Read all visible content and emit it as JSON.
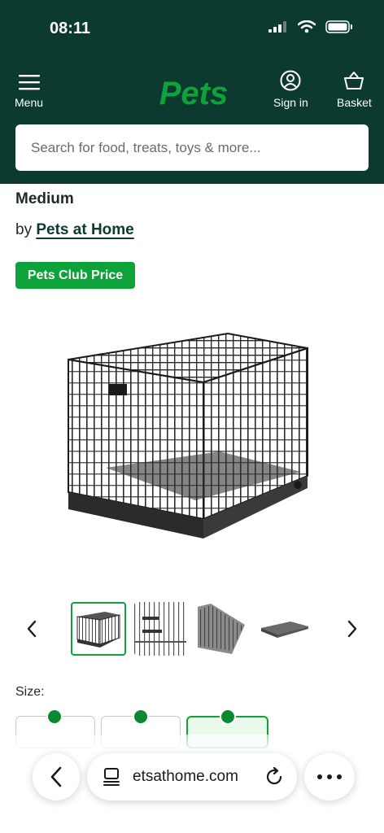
{
  "status_bar": {
    "time": "08:11"
  },
  "header": {
    "menu_label": "Menu",
    "logo_text": "Pets",
    "signin_label": "Sign in",
    "basket_label": "Basket",
    "search_placeholder": "Search for food, treats, toys & more..."
  },
  "product": {
    "title_visible": "Medium",
    "by_prefix": "by",
    "brand": "Pets at Home",
    "badge": "Pets Club Price",
    "size_label": "Size:"
  },
  "browser": {
    "url": "etsathome.com"
  },
  "colors": {
    "header_bg": "#0c3a2f",
    "accent_green": "#0da33a"
  }
}
